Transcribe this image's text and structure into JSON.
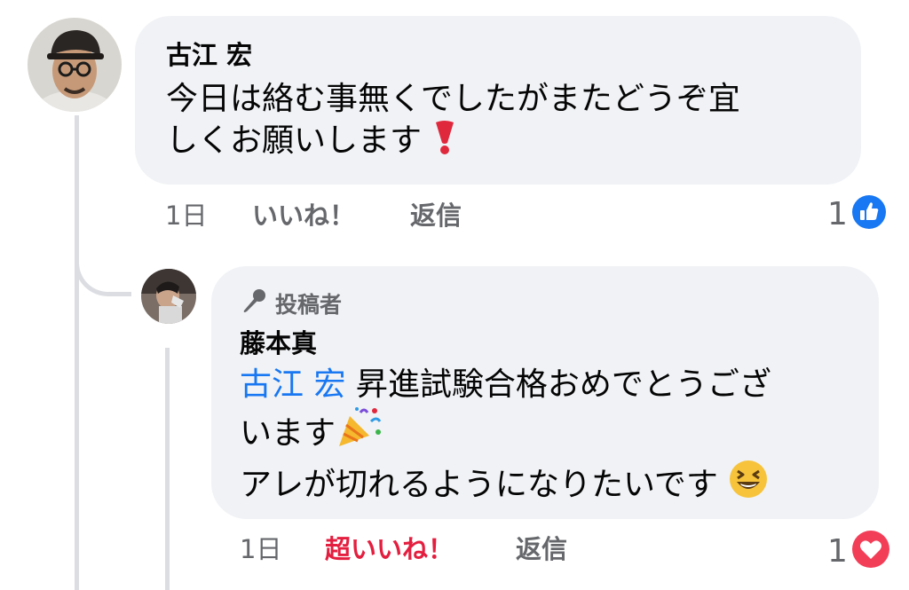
{
  "comment": {
    "author": "古江 宏",
    "text_line1": "今日は絡む事無くでしたがまたどうぞ宜",
    "text_line2": "しくお願いします",
    "emoji": "heavy-exclamation-mark-emoji",
    "time": "1日",
    "like_label": "いいね！",
    "reply_label": "返信",
    "reaction": {
      "type": "like",
      "count": "1",
      "color": "#1877f2"
    }
  },
  "reply": {
    "role_badge": "投稿者",
    "author": "藤本真",
    "mention": "古江 宏",
    "text_line1": " 昇進試験合格おめでとうござ",
    "text_line2": "います",
    "text_line3": "アレが切れるようになりたいです",
    "emojis": [
      "party-popper-emoji",
      "grinning-squinting-face-emoji"
    ],
    "time": "1日",
    "love_label": "超いいね！",
    "reply_label": "返信",
    "reaction": {
      "type": "love",
      "count": "1",
      "color": "#f33e58"
    }
  },
  "colors": {
    "bubble": "#f0f2f5",
    "secondary_text": "#65676b",
    "mention": "#1877f2",
    "love_text": "#e41e3f"
  }
}
